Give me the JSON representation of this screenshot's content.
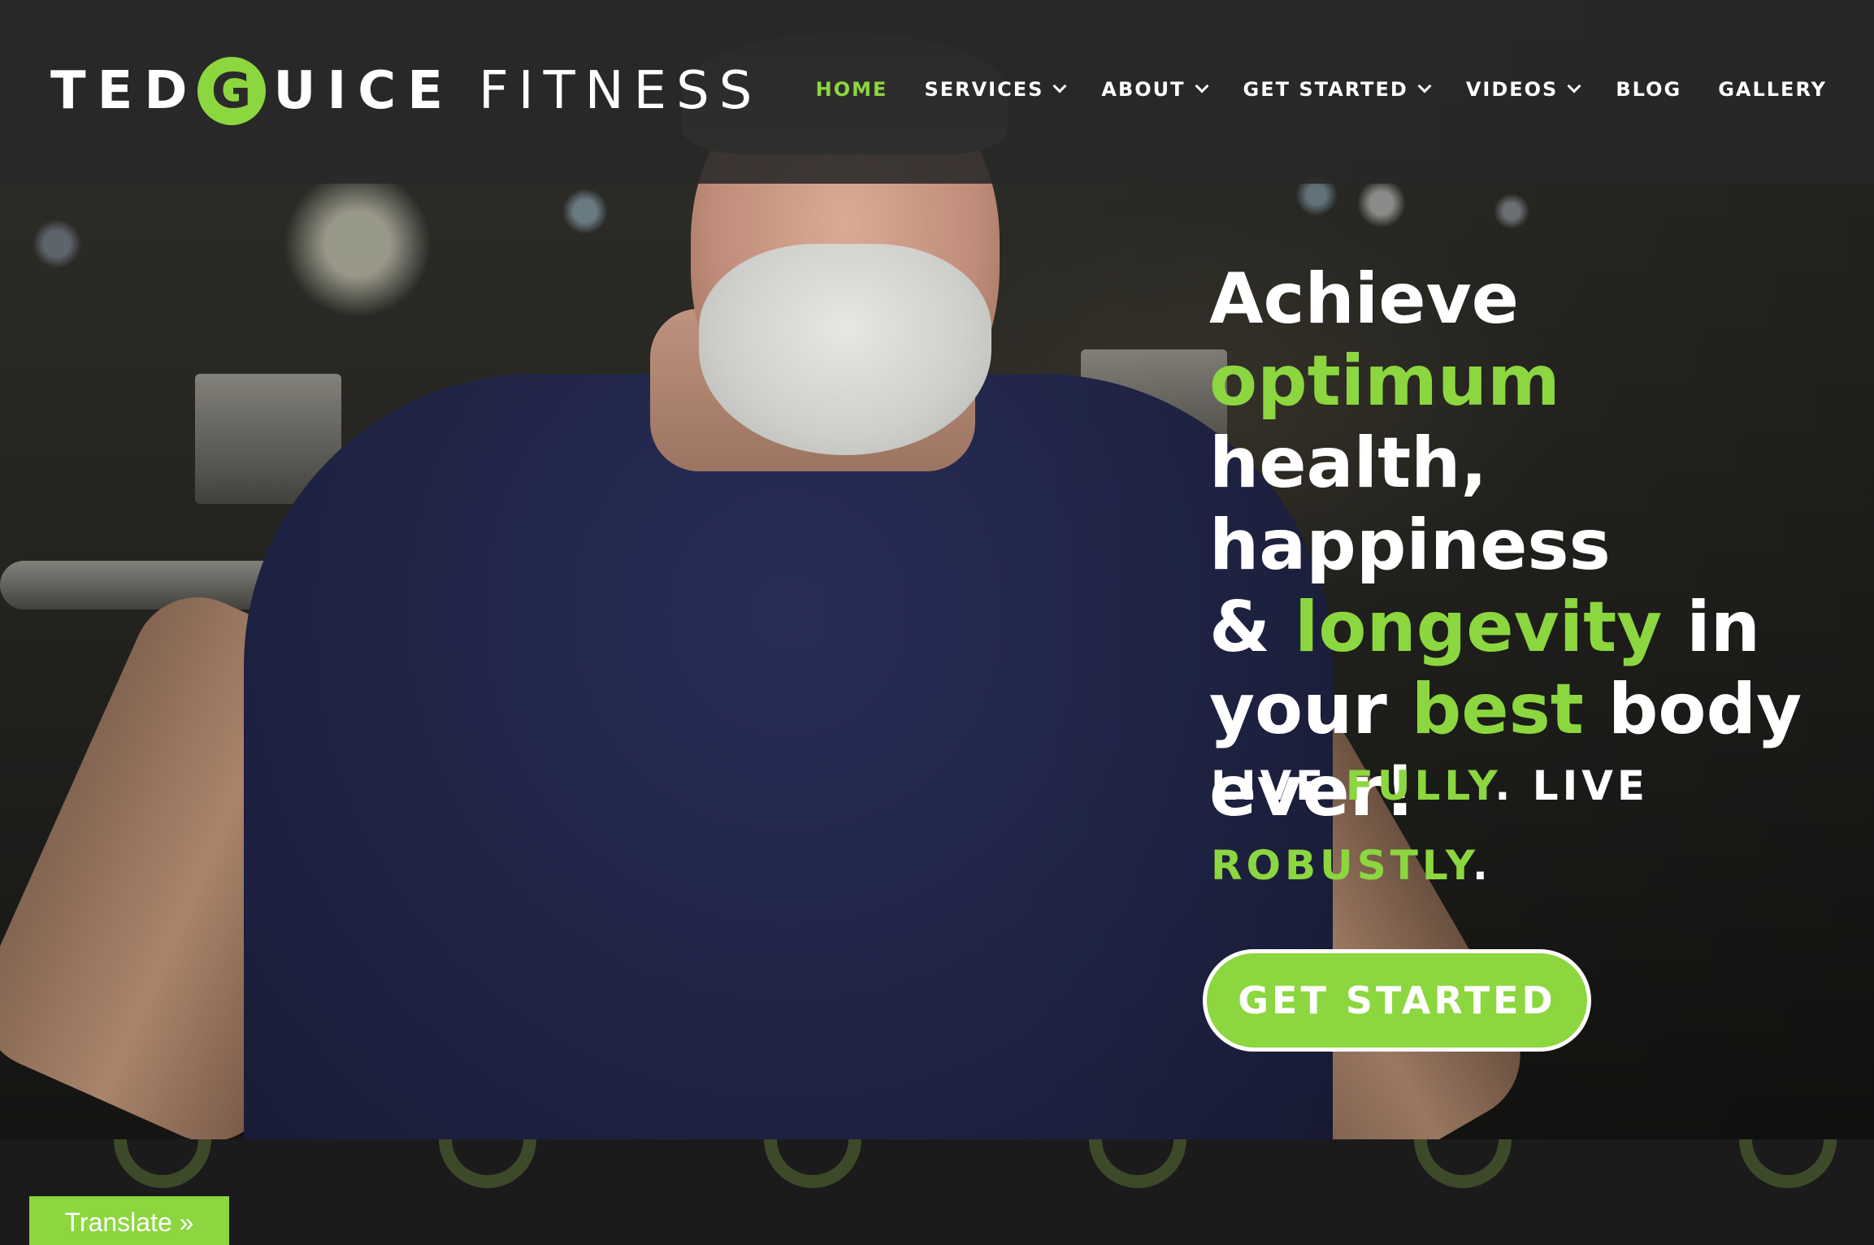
{
  "brand": {
    "logo_part1": "TED",
    "logo_g": "G",
    "logo_part2": "UICE",
    "logo_part3": "FITNESS",
    "accent_color": "#8cd640"
  },
  "nav": {
    "items": [
      {
        "label": "HOME",
        "active": true,
        "dropdown": false
      },
      {
        "label": "SERVICES",
        "active": false,
        "dropdown": true
      },
      {
        "label": "ABOUT",
        "active": false,
        "dropdown": true
      },
      {
        "label": "GET STARTED",
        "active": false,
        "dropdown": true
      },
      {
        "label": "VIDEOS",
        "active": false,
        "dropdown": true
      },
      {
        "label": "BLOG",
        "active": false,
        "dropdown": false
      },
      {
        "label": "GALLERY",
        "active": false,
        "dropdown": false
      }
    ]
  },
  "hero": {
    "headline": {
      "w1": "Achieve",
      "w2": "optimum",
      "w3": "health, happiness",
      "w4": "&",
      "w5": "longevity",
      "w6": "in",
      "w7": "your",
      "w8": "best",
      "w9": "body",
      "w10": "ever!"
    },
    "tagline": {
      "t1": "LIVE",
      "t2": "FULLY",
      "t3": ". LIVE",
      "t4": "ROBUSTLY",
      "t5": "."
    },
    "cta_label": "GET STARTED"
  },
  "footer": {
    "translate_label": "Translate »"
  }
}
